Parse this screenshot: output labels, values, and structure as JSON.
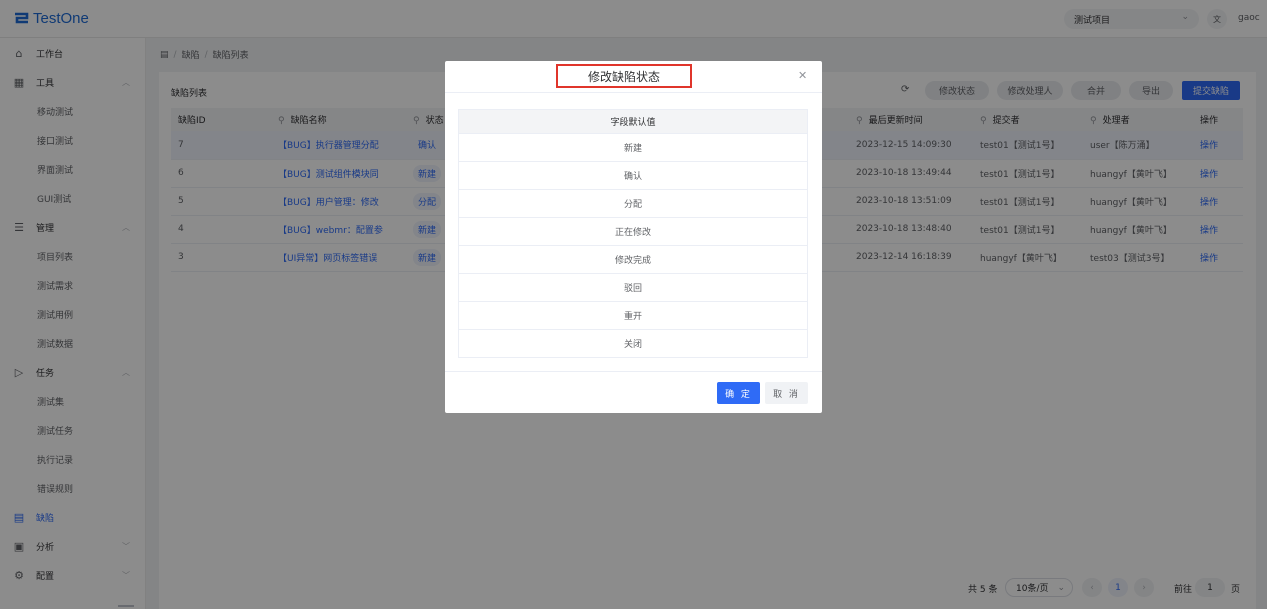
{
  "header": {
    "logo_text": "TestOne",
    "project_select": "测试项目",
    "lang_icon": "translate-icon",
    "username": "gaoc"
  },
  "sidebar": {
    "items": [
      {
        "label": "工作台",
        "icon": "home-icon",
        "level": 1
      },
      {
        "label": "工具",
        "icon": "grid-icon",
        "level": 1,
        "expanded": true
      },
      {
        "label": "移动测试",
        "level": 2
      },
      {
        "label": "接口测试",
        "level": 2
      },
      {
        "label": "界面测试",
        "level": 2
      },
      {
        "label": "GUI测试",
        "level": 2
      },
      {
        "label": "管理",
        "icon": "list-icon",
        "level": 1,
        "expanded": true
      },
      {
        "label": "项目列表",
        "level": 2
      },
      {
        "label": "测试需求",
        "level": 2
      },
      {
        "label": "测试用例",
        "level": 2
      },
      {
        "label": "测试数据",
        "level": 2
      },
      {
        "label": "任务",
        "icon": "send-icon",
        "level": 1,
        "expanded": true
      },
      {
        "label": "测试集",
        "level": 2
      },
      {
        "label": "测试任务",
        "level": 2
      },
      {
        "label": "执行记录",
        "level": 2
      },
      {
        "label": "错误规则",
        "level": 2
      },
      {
        "label": "缺陷",
        "icon": "document-icon",
        "level": 1,
        "active": true
      },
      {
        "label": "分析",
        "icon": "calendar-icon",
        "level": 1,
        "expanded": false
      },
      {
        "label": "配置",
        "icon": "gear-icon",
        "level": 1,
        "expanded": false
      }
    ]
  },
  "breadcrumb": {
    "icon": "document-icon",
    "items": [
      "缺陷",
      "缺陷列表"
    ],
    "separator": "/"
  },
  "card": {
    "title": "缺陷列表",
    "toolbar": {
      "refresh_icon": "refresh-icon",
      "change_status": "修改状态",
      "change_handler": "修改处理人",
      "merge": "合并",
      "export": "导出",
      "submit": "提交缺陷"
    },
    "table": {
      "headers": [
        "缺陷ID",
        "缺陷名称",
        "状态",
        "最后更新时间",
        "提交者",
        "处理者",
        "操作"
      ],
      "rows": [
        {
          "id": "7",
          "name": "【BUG】执行器管理分配",
          "status": "确认",
          "updated": "2023-12-15 14:09:30",
          "submitter": "test01【测试1号】",
          "handler": "user【陈万涌】",
          "op": "操作"
        },
        {
          "id": "6",
          "name": "【BUG】测试组件模块同",
          "status": "新建",
          "updated": "2023-10-18 13:49:44",
          "submitter": "test01【测试1号】",
          "handler": "huangyf【黄叶飞】",
          "op": "操作"
        },
        {
          "id": "5",
          "name": "【BUG】用户管理：修改",
          "status": "分配",
          "updated": "2023-10-18 13:51:09",
          "submitter": "test01【测试1号】",
          "handler": "huangyf【黄叶飞】",
          "op": "操作"
        },
        {
          "id": "4",
          "name": "【BUG】webmr：配置参",
          "status": "新建",
          "updated": "2023-10-18 13:48:40",
          "submitter": "test01【测试1号】",
          "handler": "huangyf【黄叶飞】",
          "op": "操作"
        },
        {
          "id": "3",
          "name": "【UI异常】网页标签错误",
          "status": "新建",
          "updated": "2023-12-14 16:18:39",
          "submitter": "huangyf【黄叶飞】",
          "handler": "test03【测试3号】",
          "op": "操作"
        }
      ]
    },
    "pager": {
      "total": "共 5 条",
      "page_size": "10条/页",
      "current_page": "1",
      "goto_prefix": "前往",
      "goto_value": "1",
      "goto_suffix": "页"
    }
  },
  "modal": {
    "title": "修改缺陷状态",
    "close_icon": "close-icon",
    "table_header": "字段默认值",
    "options": [
      "新建",
      "确认",
      "分配",
      "正在修改",
      "修改完成",
      "驳回",
      "重开",
      "关闭"
    ],
    "ok": "确 定",
    "cancel": "取 消"
  },
  "colors": {
    "accent": "#2f6bf6",
    "title_highlight": "#e0352b"
  }
}
